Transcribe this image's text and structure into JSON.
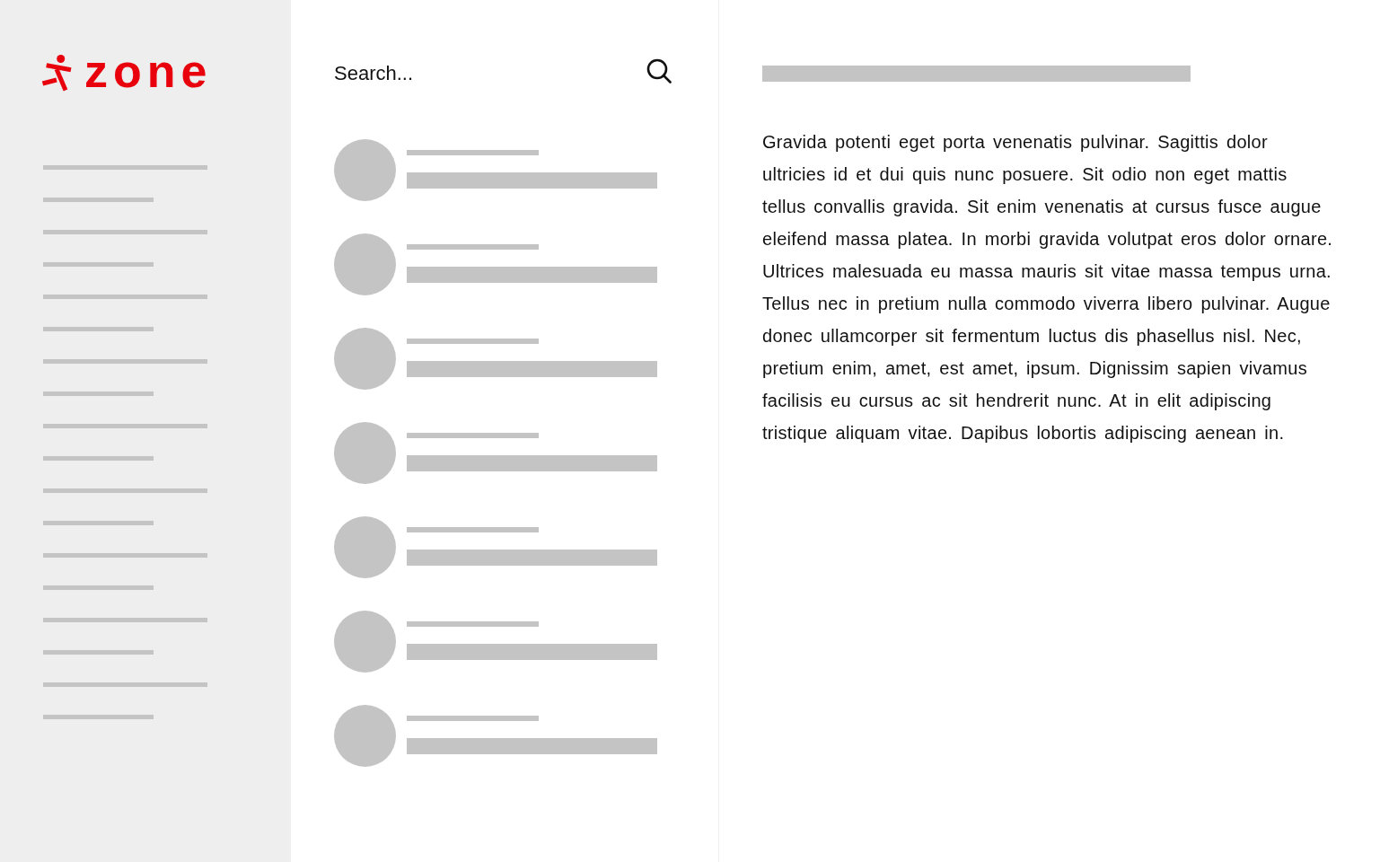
{
  "sidebar": {
    "logo": "zone",
    "items": [
      {
        "kind": "long"
      },
      {
        "kind": "short"
      },
      {
        "kind": "long"
      },
      {
        "kind": "short"
      },
      {
        "kind": "long"
      },
      {
        "kind": "short"
      },
      {
        "kind": "long"
      },
      {
        "kind": "short"
      },
      {
        "kind": "long"
      },
      {
        "kind": "short"
      },
      {
        "kind": "long"
      },
      {
        "kind": "short"
      },
      {
        "kind": "long"
      },
      {
        "kind": "short"
      },
      {
        "kind": "long"
      },
      {
        "kind": "short"
      },
      {
        "kind": "long"
      },
      {
        "kind": "short"
      }
    ]
  },
  "search": {
    "placeholder": "Search..."
  },
  "results": [
    {
      "kind": "placeholder"
    },
    {
      "kind": "placeholder"
    },
    {
      "kind": "placeholder"
    },
    {
      "kind": "placeholder"
    },
    {
      "kind": "placeholder"
    },
    {
      "kind": "placeholder"
    },
    {
      "kind": "placeholder"
    }
  ],
  "article": {
    "title": {
      "kind": "placeholder"
    },
    "body": "Gravida potenti eget porta venenatis pulvinar. Sagittis dolor ultricies id et dui quis nunc posuere. Sit odio non eget mattis tellus convallis gravida. Sit enim venenatis at cursus fusce augue eleifend massa platea. In morbi gravida volutpat eros dolor ornare. Ultrices malesuada eu massa mauris sit vitae massa tempus urna. Tellus nec in pretium nulla commodo viverra libero pulvinar. Augue donec ullamcorper sit fermentum luctus dis phasellus nisl. Nec, pretium enim, amet, est amet, ipsum. Dignissim sapien vivamus facilisis eu cursus ac sit hendrerit nunc. At in elit adipiscing tristique aliquam vitae. Dapibus lobortis adipiscing aenean in."
  }
}
